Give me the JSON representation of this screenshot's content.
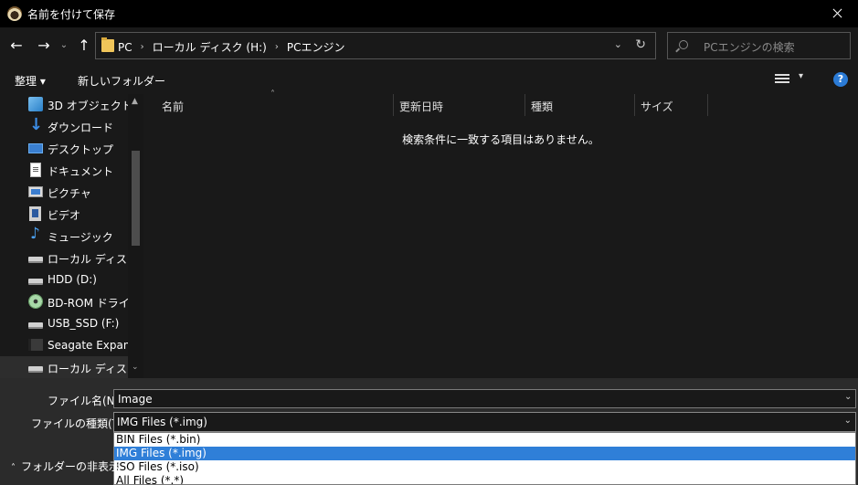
{
  "window": {
    "title": "名前を付けて保存",
    "close_icon": "close-icon"
  },
  "nav": {
    "back_icon": "←",
    "forward_icon": "→",
    "recent_icon": "⌄",
    "up_icon": "↑",
    "breadcrumb": [
      "PC",
      "ローカル ディスク (H:)",
      "PCエンジン"
    ],
    "dropdown_icon": "⌄",
    "refresh_icon": "↻",
    "search_placeholder": "PCエンジンの検索"
  },
  "toolbar": {
    "organize_label": "整理 ▾",
    "new_folder_label": "新しいフォルダー",
    "view_caret": "▾",
    "help_label": "?"
  },
  "sidebar": {
    "items": [
      {
        "label": "3D オブジェクト",
        "icon": "3d-objects-icon"
      },
      {
        "label": "ダウンロード",
        "icon": "download-icon"
      },
      {
        "label": "デスクトップ",
        "icon": "desktop-icon"
      },
      {
        "label": "ドキュメント",
        "icon": "document-icon"
      },
      {
        "label": "ピクチャ",
        "icon": "pictures-icon"
      },
      {
        "label": "ビデオ",
        "icon": "video-icon"
      },
      {
        "label": "ミュージック",
        "icon": "music-icon"
      },
      {
        "label": "ローカル ディスク (C",
        "icon": "drive-icon"
      },
      {
        "label": "HDD (D:)",
        "icon": "drive-icon"
      },
      {
        "label": "BD-ROM ドライブ",
        "icon": "bd-rom-icon"
      },
      {
        "label": "USB_SSD (F:)",
        "icon": "drive-icon"
      },
      {
        "label": "Seagate Expansic",
        "icon": "external-drive-icon"
      },
      {
        "label": "ローカル ディスク (H",
        "icon": "drive-icon"
      }
    ],
    "scroll_up": "▲",
    "scroll_down": "⌄"
  },
  "filelist": {
    "sort_indicator": "˄",
    "columns": [
      "名前",
      "更新日時",
      "種類",
      "サイズ"
    ],
    "empty_message": "検索条件に一致する項目はありません。"
  },
  "form": {
    "filename_label": "ファイル名(N):",
    "filename_value": "Image",
    "filetype_label": "ファイルの種類(T):",
    "filetype_value": "IMG Files (*.img)",
    "caret": "⌄",
    "filetype_options": [
      {
        "label": "BIN Files (*.bin)",
        "selected": false
      },
      {
        "label": "IMG Files (*.img)",
        "selected": true
      },
      {
        "label": "ISO Files (*.iso)",
        "selected": false
      },
      {
        "label": "All Files (*.*)",
        "selected": false
      }
    ],
    "hide_folders_caret": "˄",
    "hide_folders_label": "フォルダーの非表示"
  },
  "colors": {
    "background": "#191919",
    "panel": "#2b2b2b",
    "selection": "#2f7fd8",
    "help": "#2b7bd6"
  }
}
